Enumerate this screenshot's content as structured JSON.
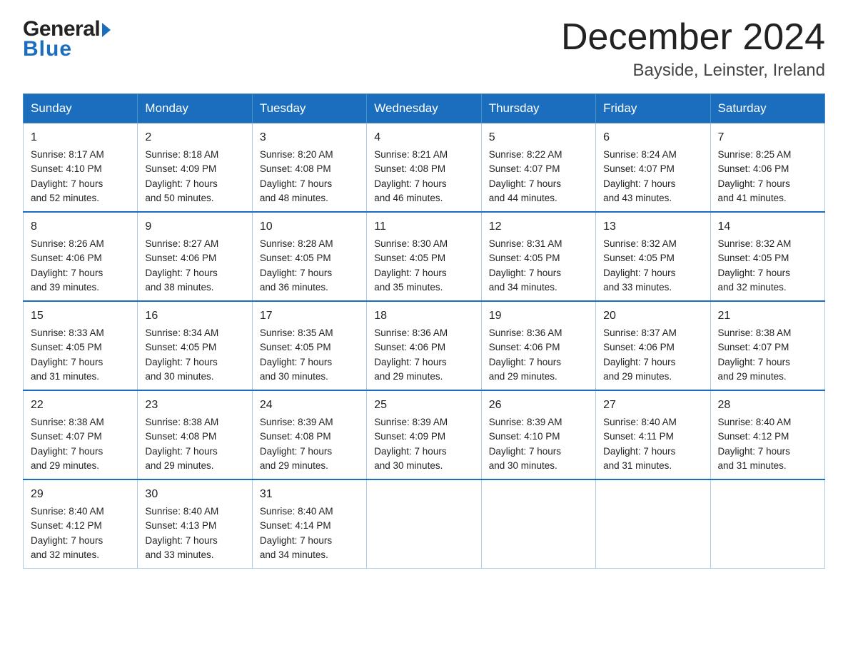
{
  "logo": {
    "general": "General",
    "blue": "Blue",
    "triangle": "▶"
  },
  "title": "December 2024",
  "subtitle": "Bayside, Leinster, Ireland",
  "weekdays": [
    "Sunday",
    "Monday",
    "Tuesday",
    "Wednesday",
    "Thursday",
    "Friday",
    "Saturday"
  ],
  "weeks": [
    [
      {
        "day": "1",
        "sunrise": "8:17 AM",
        "sunset": "4:10 PM",
        "daylight": "7 hours and 52 minutes."
      },
      {
        "day": "2",
        "sunrise": "8:18 AM",
        "sunset": "4:09 PM",
        "daylight": "7 hours and 50 minutes."
      },
      {
        "day": "3",
        "sunrise": "8:20 AM",
        "sunset": "4:08 PM",
        "daylight": "7 hours and 48 minutes."
      },
      {
        "day": "4",
        "sunrise": "8:21 AM",
        "sunset": "4:08 PM",
        "daylight": "7 hours and 46 minutes."
      },
      {
        "day": "5",
        "sunrise": "8:22 AM",
        "sunset": "4:07 PM",
        "daylight": "7 hours and 44 minutes."
      },
      {
        "day": "6",
        "sunrise": "8:24 AM",
        "sunset": "4:07 PM",
        "daylight": "7 hours and 43 minutes."
      },
      {
        "day": "7",
        "sunrise": "8:25 AM",
        "sunset": "4:06 PM",
        "daylight": "7 hours and 41 minutes."
      }
    ],
    [
      {
        "day": "8",
        "sunrise": "8:26 AM",
        "sunset": "4:06 PM",
        "daylight": "7 hours and 39 minutes."
      },
      {
        "day": "9",
        "sunrise": "8:27 AM",
        "sunset": "4:06 PM",
        "daylight": "7 hours and 38 minutes."
      },
      {
        "day": "10",
        "sunrise": "8:28 AM",
        "sunset": "4:05 PM",
        "daylight": "7 hours and 36 minutes."
      },
      {
        "day": "11",
        "sunrise": "8:30 AM",
        "sunset": "4:05 PM",
        "daylight": "7 hours and 35 minutes."
      },
      {
        "day": "12",
        "sunrise": "8:31 AM",
        "sunset": "4:05 PM",
        "daylight": "7 hours and 34 minutes."
      },
      {
        "day": "13",
        "sunrise": "8:32 AM",
        "sunset": "4:05 PM",
        "daylight": "7 hours and 33 minutes."
      },
      {
        "day": "14",
        "sunrise": "8:32 AM",
        "sunset": "4:05 PM",
        "daylight": "7 hours and 32 minutes."
      }
    ],
    [
      {
        "day": "15",
        "sunrise": "8:33 AM",
        "sunset": "4:05 PM",
        "daylight": "7 hours and 31 minutes."
      },
      {
        "day": "16",
        "sunrise": "8:34 AM",
        "sunset": "4:05 PM",
        "daylight": "7 hours and 30 minutes."
      },
      {
        "day": "17",
        "sunrise": "8:35 AM",
        "sunset": "4:05 PM",
        "daylight": "7 hours and 30 minutes."
      },
      {
        "day": "18",
        "sunrise": "8:36 AM",
        "sunset": "4:06 PM",
        "daylight": "7 hours and 29 minutes."
      },
      {
        "day": "19",
        "sunrise": "8:36 AM",
        "sunset": "4:06 PM",
        "daylight": "7 hours and 29 minutes."
      },
      {
        "day": "20",
        "sunrise": "8:37 AM",
        "sunset": "4:06 PM",
        "daylight": "7 hours and 29 minutes."
      },
      {
        "day": "21",
        "sunrise": "8:38 AM",
        "sunset": "4:07 PM",
        "daylight": "7 hours and 29 minutes."
      }
    ],
    [
      {
        "day": "22",
        "sunrise": "8:38 AM",
        "sunset": "4:07 PM",
        "daylight": "7 hours and 29 minutes."
      },
      {
        "day": "23",
        "sunrise": "8:38 AM",
        "sunset": "4:08 PM",
        "daylight": "7 hours and 29 minutes."
      },
      {
        "day": "24",
        "sunrise": "8:39 AM",
        "sunset": "4:08 PM",
        "daylight": "7 hours and 29 minutes."
      },
      {
        "day": "25",
        "sunrise": "8:39 AM",
        "sunset": "4:09 PM",
        "daylight": "7 hours and 30 minutes."
      },
      {
        "day": "26",
        "sunrise": "8:39 AM",
        "sunset": "4:10 PM",
        "daylight": "7 hours and 30 minutes."
      },
      {
        "day": "27",
        "sunrise": "8:40 AM",
        "sunset": "4:11 PM",
        "daylight": "7 hours and 31 minutes."
      },
      {
        "day": "28",
        "sunrise": "8:40 AM",
        "sunset": "4:12 PM",
        "daylight": "7 hours and 31 minutes."
      }
    ],
    [
      {
        "day": "29",
        "sunrise": "8:40 AM",
        "sunset": "4:12 PM",
        "daylight": "7 hours and 32 minutes."
      },
      {
        "day": "30",
        "sunrise": "8:40 AM",
        "sunset": "4:13 PM",
        "daylight": "7 hours and 33 minutes."
      },
      {
        "day": "31",
        "sunrise": "8:40 AM",
        "sunset": "4:14 PM",
        "daylight": "7 hours and 34 minutes."
      },
      null,
      null,
      null,
      null
    ]
  ],
  "labels": {
    "sunrise": "Sunrise:",
    "sunset": "Sunset:",
    "daylight": "Daylight:"
  }
}
